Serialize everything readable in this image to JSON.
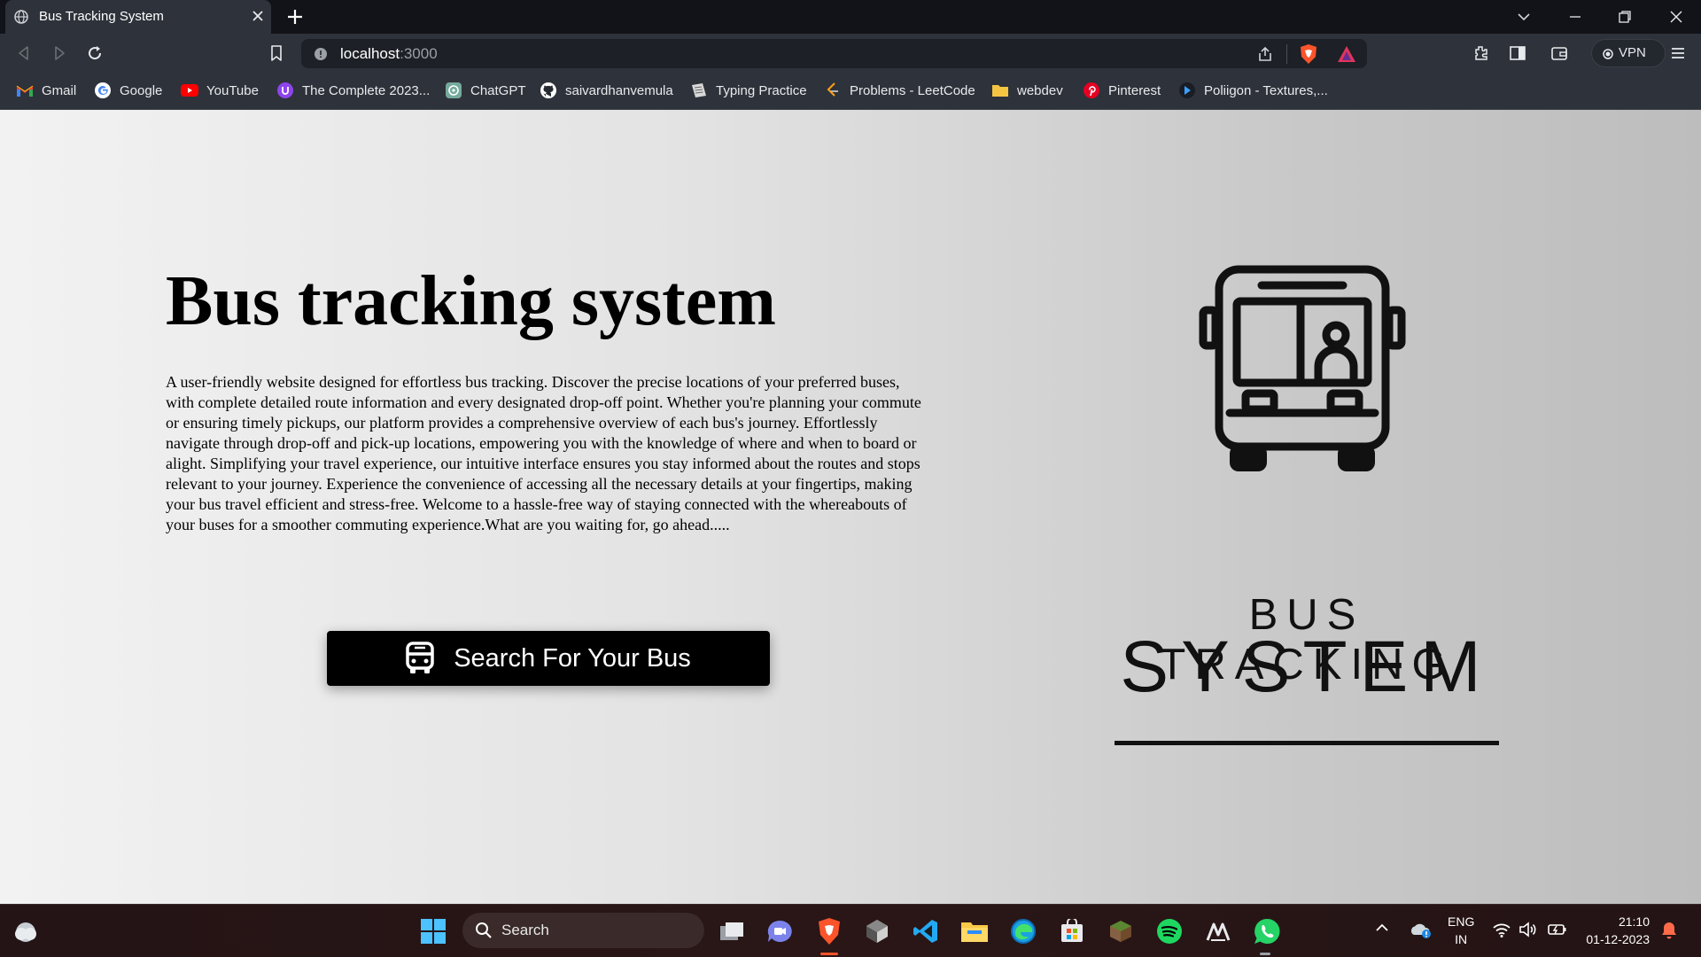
{
  "browser": {
    "tab_title": "Bus Tracking System",
    "url_host": "localhost",
    "url_port": ":3000",
    "vpn_label": "VPN"
  },
  "bookmarks": [
    {
      "label": "Gmail",
      "icon": "gmail-icon"
    },
    {
      "label": "Google",
      "icon": "google-icon"
    },
    {
      "label": "YouTube",
      "icon": "youtube-icon"
    },
    {
      "label": "The Complete 2023...",
      "icon": "udemy-icon"
    },
    {
      "label": "ChatGPT",
      "icon": "chatgpt-icon"
    },
    {
      "label": "saivardhanvemula",
      "icon": "github-icon"
    },
    {
      "label": "Typing Practice",
      "icon": "typing-icon"
    },
    {
      "label": "Problems - LeetCode",
      "icon": "leetcode-icon"
    },
    {
      "label": "webdev",
      "icon": "folder-icon"
    },
    {
      "label": "Pinterest",
      "icon": "pinterest-icon"
    },
    {
      "label": "Poliigon - Textures,...",
      "icon": "poliigon-icon"
    }
  ],
  "page": {
    "title": "Bus tracking system",
    "description": "A user-friendly website designed for effortless bus tracking. Discover the precise locations of your preferred buses, with complete detailed route information and every designated drop-off point. Whether you're planning your commute or ensuring timely pickups, our platform provides a comprehensive overview of each bus's journey. Effortlessly navigate through drop-off and pick-up locations, empowering you with the knowledge of where and when to board or alight. Simplifying your travel experience, our intuitive interface ensures you stay informed about the routes and stops relevant to your journey. Experience the convenience of accessing all the necessary details at your fingertips, making your bus travel efficient and stress-free. Welcome to a hassle-free way of staying connected with the whereabouts of your buses for a smoother commuting experience.What are you waiting for, go ahead.....",
    "search_button_label": "Search For Your Bus",
    "logo_line1": "BUS TRACKING",
    "logo_line2": "SYSTEM"
  },
  "taskbar": {
    "search_label": "Search",
    "lang_line1": "ENG",
    "lang_line2": "IN",
    "time": "21:10",
    "date": "01-12-2023"
  },
  "colors": {
    "page_text": "#000000",
    "button_bg": "#000000",
    "button_text": "#ffffff",
    "browser_chrome": "#2e323a",
    "brave_orange": "#fb542b"
  }
}
